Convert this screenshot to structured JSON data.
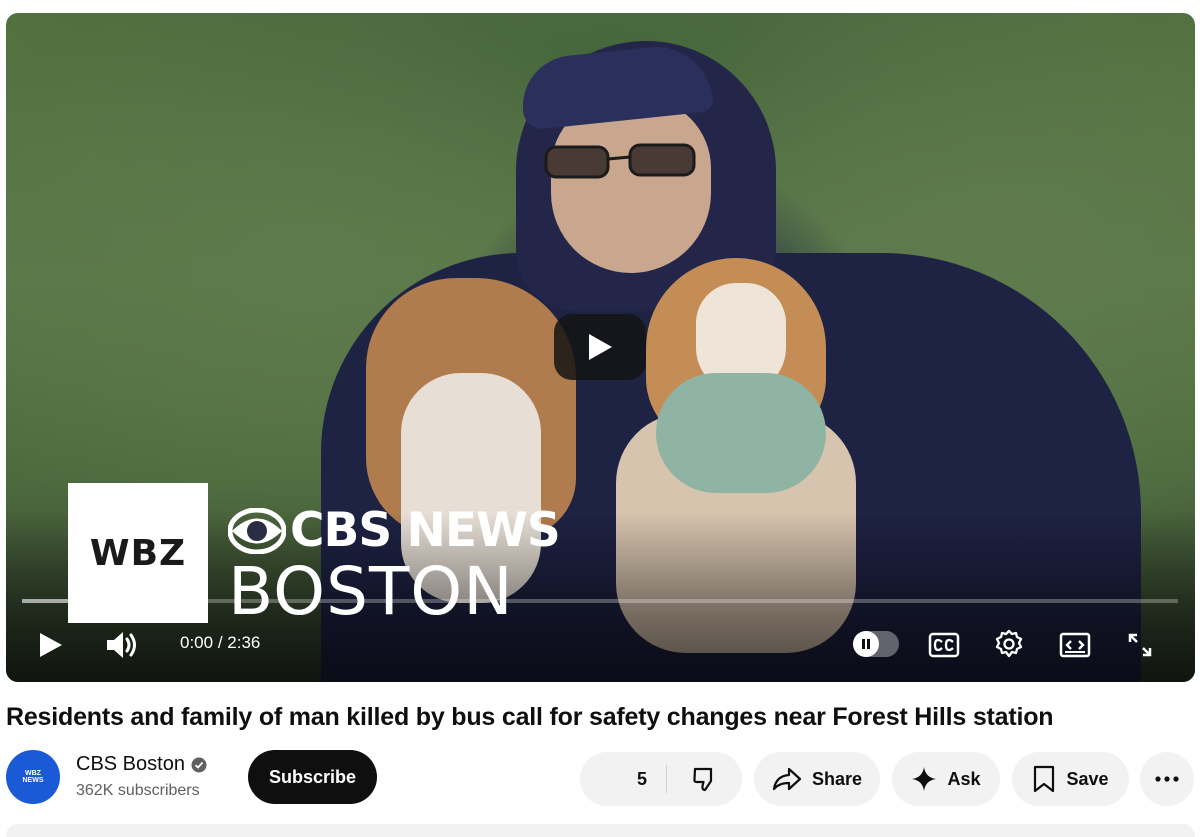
{
  "player": {
    "overlay_logo": {
      "station": "WBZ",
      "network_line1": "CBS NEWS",
      "network_line2": "BOSTON"
    },
    "time_current": "0:00",
    "time_separator": " / ",
    "time_total": "2:36",
    "progress_fraction": 0.0,
    "buffered_fraction": 0.14,
    "icons": {
      "big_play": "play-icon",
      "play": "play-icon",
      "volume": "volume-icon",
      "autoplay": "autoplay-pause-icon",
      "captions": "captions-icon",
      "settings": "gear-icon",
      "miniplayer": "miniplayer-icon",
      "fullscreen": "fullscreen-icon"
    }
  },
  "video": {
    "title": "Residents and family of man killed by bus call for safety changes near Forest Hills station"
  },
  "channel": {
    "avatar_text_line1": "WBZ",
    "avatar_text_line2": "NEWS",
    "name": "CBS Boston",
    "verified": true,
    "subscribers": "362K subscribers",
    "subscribe_label": "Subscribe"
  },
  "actions": {
    "like_count": "5",
    "share_label": "Share",
    "ask_label": "Ask",
    "save_label": "Save"
  },
  "colors": {
    "subscribe_bg": "#0f0f0f",
    "pill_bg": "#f2f2f2",
    "avatar_bg": "#1b5ad6"
  }
}
